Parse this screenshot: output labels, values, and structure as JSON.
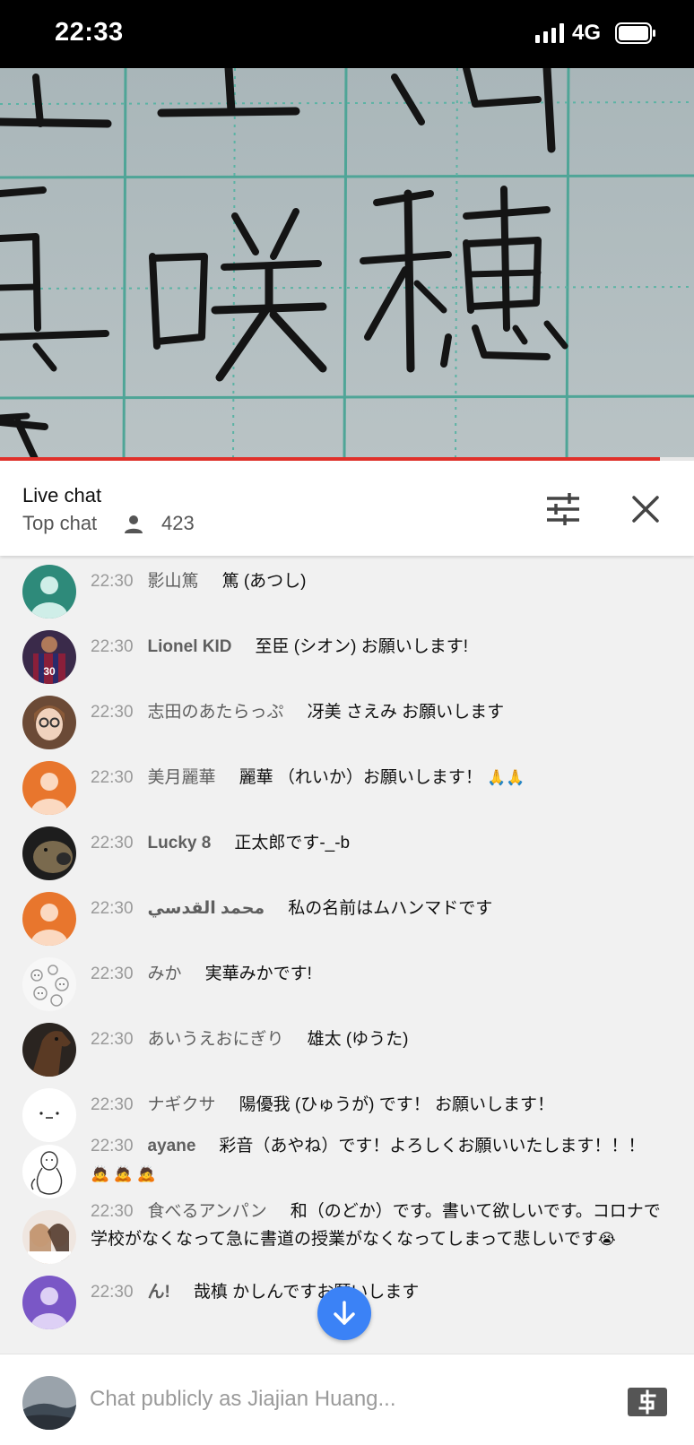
{
  "status_bar": {
    "time": "22:33",
    "network": "4G"
  },
  "video": {
    "progress": 0.951
  },
  "chat_header": {
    "title": "Live chat",
    "mode": "Top chat",
    "viewer_count": "423"
  },
  "messages": [
    {
      "time": "22:30",
      "author": "影山篤",
      "text": "篤 (あつし)"
    },
    {
      "time": "22:30",
      "author": "Lionel KID",
      "text": "至臣 (シオン) お願いします!"
    },
    {
      "time": "22:30",
      "author": "志田のあたらっぷ",
      "text": "冴美 さえみ お願いします"
    },
    {
      "time": "22:30",
      "author": "美月麗華",
      "text": "麗華 （れいか）お願いします！",
      "emoji": "🙏🙏"
    },
    {
      "time": "22:30",
      "author": "Lucky 8",
      "text": "正太郎です-_-b"
    },
    {
      "time": "22:30",
      "author": "محمد القدسي",
      "text": "私の名前はムハンマドです"
    },
    {
      "time": "22:30",
      "author": "みか",
      "text": "実華みかです!"
    },
    {
      "time": "22:30",
      "author": "あいうえおにぎり",
      "text": "雄太 (ゆうた)"
    },
    {
      "time": "22:30",
      "author": "ナギクサ",
      "text": "陽優我 (ひゅうが) です！ お願いします！"
    },
    {
      "time": "22:30",
      "author": "ayane",
      "text": "彩音（あやね）です！よろしくお願いいたします！！！",
      "emoji": "🙇 🙇 🙇"
    },
    {
      "time": "22:30",
      "author": "食べるアンパン",
      "text": "和（のどか）です。書いて欲しいです。コロナで学校がなくなって急に書道の授業がなくなってしまって悲しいです",
      "emoji": "😭"
    },
    {
      "time": "22:30",
      "author": "ん!",
      "text": "哉槙 かしんですお願いします"
    }
  ],
  "input": {
    "placeholder": "Chat publicly as Jiajian Huang..."
  },
  "icons": {
    "signal": "signal-bars-icon",
    "battery": "battery-icon",
    "viewer": "person-icon",
    "filter": "sliders-icon",
    "close": "close-icon",
    "scroll": "arrow-down-icon",
    "superchat": "dollar-icon"
  },
  "colors": {
    "progress": "#e0302a",
    "scroll_button": "#3b82f6"
  }
}
